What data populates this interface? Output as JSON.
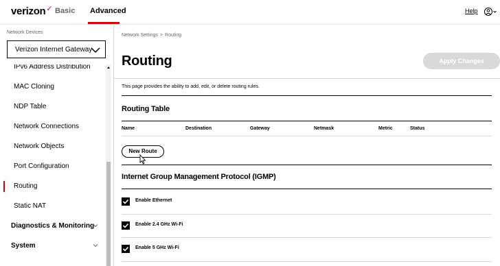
{
  "header": {
    "logo_text": "verizon",
    "logo_mark": "✓",
    "tabs": [
      {
        "label": "Basic",
        "active": false
      },
      {
        "label": "Advanced",
        "active": true
      }
    ],
    "help_label": "Help",
    "user_icon": "user-circle-icon",
    "accent_color": "#cd040b"
  },
  "sidebar": {
    "heading": "Network Devices",
    "device_select": {
      "value": "Verizon Internet Gateway"
    },
    "items": [
      {
        "label": "IPv6 Address Distribution",
        "active": false
      },
      {
        "label": "MAC Cloning",
        "active": false
      },
      {
        "label": "NDP Table",
        "active": false
      },
      {
        "label": "Network Connections",
        "active": false
      },
      {
        "label": "Network Objects",
        "active": false
      },
      {
        "label": "Port Configuration",
        "active": false
      },
      {
        "label": "Routing",
        "active": true
      },
      {
        "label": "Static NAT",
        "active": false
      }
    ],
    "sections": [
      {
        "label": "Diagnostics & Monitoring",
        "expanded": false
      },
      {
        "label": "System",
        "expanded": false
      }
    ]
  },
  "main": {
    "breadcrumb": [
      "Network Settings",
      "Routing"
    ],
    "breadcrumb_separator": ">",
    "title": "Routing",
    "apply_button": {
      "label": "Apply Changes",
      "enabled": false
    },
    "description": "This page provides the ability to add, edit, or delete routing rules.",
    "routing_table": {
      "title": "Routing Table",
      "columns": [
        "Name",
        "Destination",
        "Gateway",
        "Netmask",
        "Metric",
        "Status"
      ],
      "rows": [],
      "new_route_label": "New Route"
    },
    "igmp": {
      "title": "Internet Group Management Protocol (IGMP)",
      "options": [
        {
          "label": "Enable Ethernet",
          "checked": true
        },
        {
          "label": "Enable 2.4 GHz Wi-Fi",
          "checked": true
        },
        {
          "label": "Enable 5 GHz Wi-Fi",
          "checked": true
        }
      ]
    }
  }
}
